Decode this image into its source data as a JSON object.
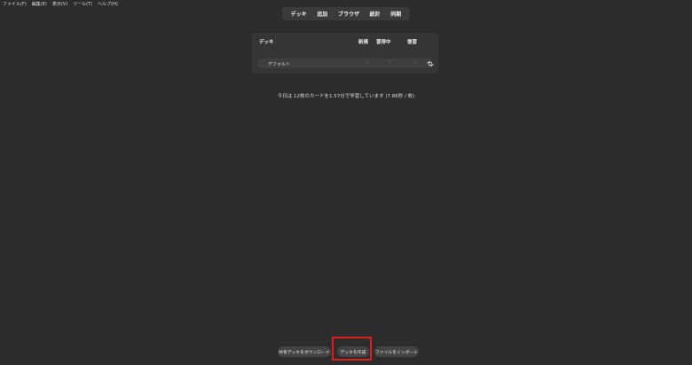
{
  "menubar": {
    "items": [
      "ファイル(F)",
      "編集(E)",
      "表示(V)",
      "ツール(T)",
      "ヘルプ(H)"
    ]
  },
  "toolbar": {
    "decks": "デッキ",
    "add": "追加",
    "browse": "ブラウザ",
    "stats": "統計",
    "sync": "同期"
  },
  "deck_table": {
    "headers": {
      "deck": "デッキ",
      "new": "新規",
      "learning": "習得中",
      "review": "復習"
    },
    "rows": [
      {
        "name": "デフォルト",
        "new": "0",
        "learning": "0",
        "review": "0"
      }
    ]
  },
  "study_stats": "今日は 12枚のカードを1.57分で学習しています (7.86秒 / 枚)",
  "bottom_buttons": {
    "shared": "共有デッキをダウンロード",
    "create": "デッキを作成",
    "import": "ファイルをインポート"
  },
  "colors": {
    "background": "#2c2c2c",
    "highlight": "#e11c1c"
  }
}
